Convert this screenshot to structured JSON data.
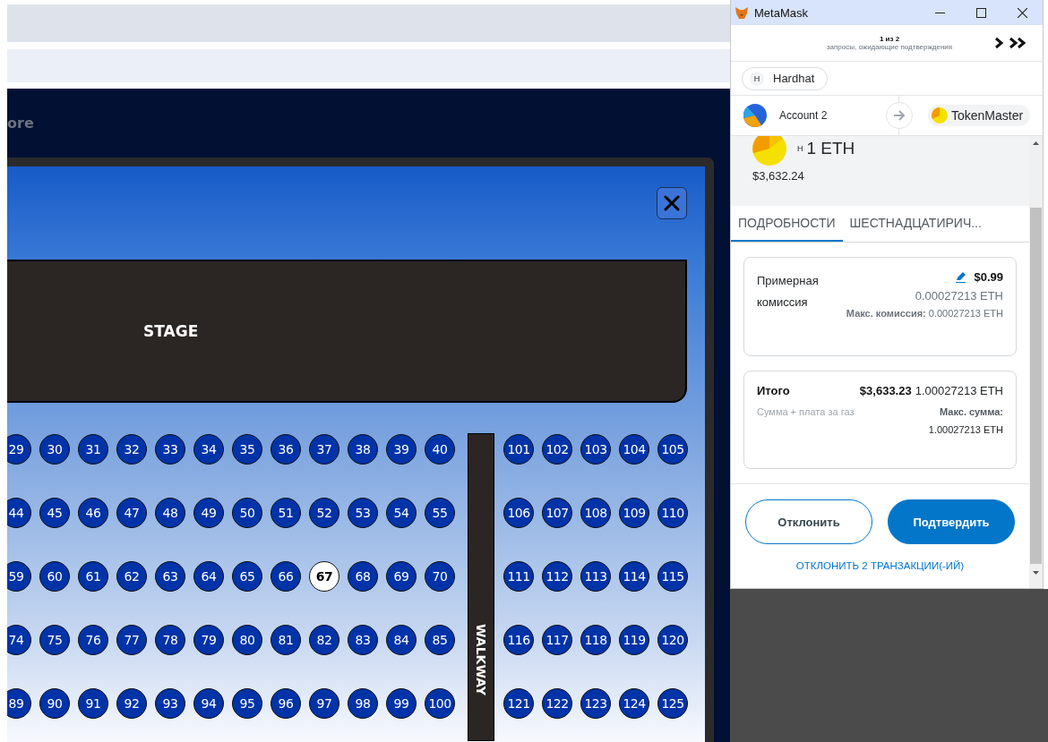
{
  "browser": {
    "nav_text": "ore"
  },
  "seat_modal": {
    "stage_label": "STAGE",
    "walkway_label": "WALKWAY",
    "rows": [
      {
        "left": [
          {
            "number": "29",
            "selected": false
          },
          {
            "number": "30",
            "selected": false
          },
          {
            "number": "31",
            "selected": false
          },
          {
            "number": "32",
            "selected": false
          },
          {
            "number": "33",
            "selected": false
          },
          {
            "number": "34",
            "selected": false
          },
          {
            "number": "35",
            "selected": false
          },
          {
            "number": "36",
            "selected": false
          },
          {
            "number": "37",
            "selected": false
          },
          {
            "number": "38",
            "selected": false
          },
          {
            "number": "39",
            "selected": false
          },
          {
            "number": "40",
            "selected": false
          }
        ],
        "right": [
          {
            "number": "101",
            "selected": false
          },
          {
            "number": "102",
            "selected": false
          },
          {
            "number": "103",
            "selected": false
          },
          {
            "number": "104",
            "selected": false
          },
          {
            "number": "105",
            "selected": false
          }
        ]
      },
      {
        "left": [
          {
            "number": "44",
            "selected": false
          },
          {
            "number": "45",
            "selected": false
          },
          {
            "number": "46",
            "selected": false
          },
          {
            "number": "47",
            "selected": false
          },
          {
            "number": "48",
            "selected": false
          },
          {
            "number": "49",
            "selected": false
          },
          {
            "number": "50",
            "selected": false
          },
          {
            "number": "51",
            "selected": false
          },
          {
            "number": "52",
            "selected": false
          },
          {
            "number": "53",
            "selected": false
          },
          {
            "number": "54",
            "selected": false
          },
          {
            "number": "55",
            "selected": false
          }
        ],
        "right": [
          {
            "number": "106",
            "selected": false
          },
          {
            "number": "107",
            "selected": false
          },
          {
            "number": "108",
            "selected": false
          },
          {
            "number": "109",
            "selected": false
          },
          {
            "number": "110",
            "selected": false
          }
        ]
      },
      {
        "left": [
          {
            "number": "59",
            "selected": false
          },
          {
            "number": "60",
            "selected": false
          },
          {
            "number": "61",
            "selected": false
          },
          {
            "number": "62",
            "selected": false
          },
          {
            "number": "63",
            "selected": false
          },
          {
            "number": "64",
            "selected": false
          },
          {
            "number": "65",
            "selected": false
          },
          {
            "number": "66",
            "selected": false
          },
          {
            "number": "67",
            "selected": true
          },
          {
            "number": "68",
            "selected": false
          },
          {
            "number": "69",
            "selected": false
          },
          {
            "number": "70",
            "selected": false
          }
        ],
        "right": [
          {
            "number": "111",
            "selected": false
          },
          {
            "number": "112",
            "selected": false
          },
          {
            "number": "113",
            "selected": false
          },
          {
            "number": "114",
            "selected": false
          },
          {
            "number": "115",
            "selected": false
          }
        ]
      },
      {
        "left": [
          {
            "number": "74",
            "selected": false
          },
          {
            "number": "75",
            "selected": false
          },
          {
            "number": "76",
            "selected": false
          },
          {
            "number": "77",
            "selected": false
          },
          {
            "number": "78",
            "selected": false
          },
          {
            "number": "79",
            "selected": false
          },
          {
            "number": "80",
            "selected": false
          },
          {
            "number": "81",
            "selected": false
          },
          {
            "number": "82",
            "selected": false
          },
          {
            "number": "83",
            "selected": false
          },
          {
            "number": "84",
            "selected": false
          },
          {
            "number": "85",
            "selected": false
          }
        ],
        "right": [
          {
            "number": "116",
            "selected": false
          },
          {
            "number": "117",
            "selected": false
          },
          {
            "number": "118",
            "selected": false
          },
          {
            "number": "119",
            "selected": false
          },
          {
            "number": "120",
            "selected": false
          }
        ]
      },
      {
        "left": [
          {
            "number": "89",
            "selected": false
          },
          {
            "number": "90",
            "selected": false
          },
          {
            "number": "91",
            "selected": false
          },
          {
            "number": "92",
            "selected": false
          },
          {
            "number": "93",
            "selected": false
          },
          {
            "number": "94",
            "selected": false
          },
          {
            "number": "95",
            "selected": false
          },
          {
            "number": "96",
            "selected": false
          },
          {
            "number": "97",
            "selected": false
          },
          {
            "number": "98",
            "selected": false
          },
          {
            "number": "99",
            "selected": false
          },
          {
            "number": "100",
            "selected": false
          }
        ],
        "right": [
          {
            "number": "121",
            "selected": false
          },
          {
            "number": "122",
            "selected": false
          },
          {
            "number": "123",
            "selected": false
          },
          {
            "number": "124",
            "selected": false
          },
          {
            "number": "125",
            "selected": false
          }
        ]
      }
    ]
  },
  "metamask": {
    "window": {
      "title": "MetaMask"
    },
    "queue": {
      "counter": "1 из 2",
      "caption": "запросы, ожидающие подтверждения"
    },
    "network": {
      "badge": "H",
      "name": "Hardhat"
    },
    "from_account": "Account 2",
    "to_account": "TokenMaster",
    "amount": {
      "badge": "H",
      "value": "1 ETH",
      "fiat": "$3,632.24"
    },
    "tabs": [
      {
        "label": "ПОДРОБНОСТИ",
        "selected": true
      },
      {
        "label": "ШЕСТНАДЦАТИРИЧ...",
        "selected": false
      }
    ],
    "fee": {
      "label": "Примерная комиссия",
      "fiat": "$0.99",
      "eth": "0.00027213 ETH",
      "max": "**Макс. комиссия:** 0.00027213 ETH"
    },
    "total": {
      "label": "Итого",
      "fiat": "$3,633.23",
      "eth": "1.00027213 ETH",
      "subtitle": "Сумма + плата за газ",
      "max_label": "Макс. сумма:",
      "max_value": "1.00027213 ETH"
    },
    "buttons": {
      "reject": "Отклонить",
      "confirm": "Подтвердить"
    },
    "reject_all": "ОТКЛОНИТЬ 2 ТРАНЗАКЦИИ(-ИЙ)"
  }
}
